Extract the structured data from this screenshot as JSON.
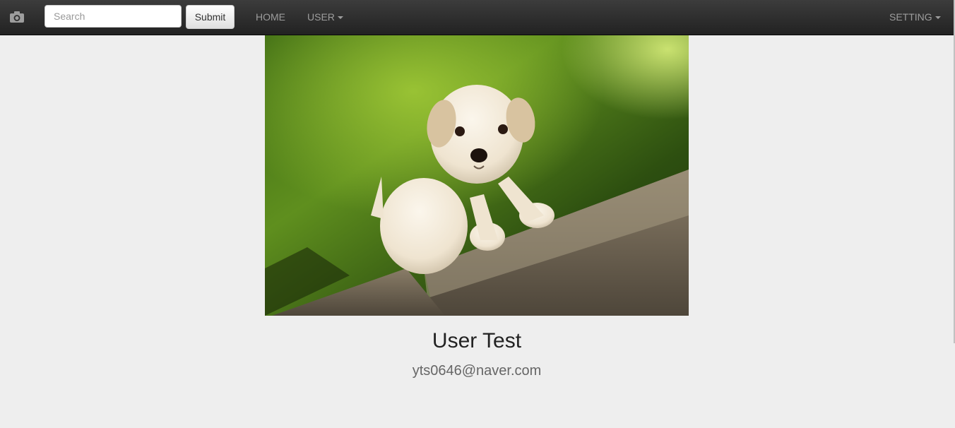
{
  "navbar": {
    "brand_icon": "camera-icon",
    "search": {
      "placeholder": "Search",
      "value": ""
    },
    "submit_label": "Submit",
    "links": {
      "home": "HOME",
      "user": "USER",
      "setting": "SETTING"
    },
    "caret_icon": "caret-down-icon"
  },
  "profile": {
    "photo_subject": "white puppy on grass",
    "name": "User Test",
    "email": "yts0646@naver.com"
  },
  "colors": {
    "navbar": "#2b2b2b",
    "page_background": "#eeeeee",
    "nav_link": "#9d9d9d"
  }
}
